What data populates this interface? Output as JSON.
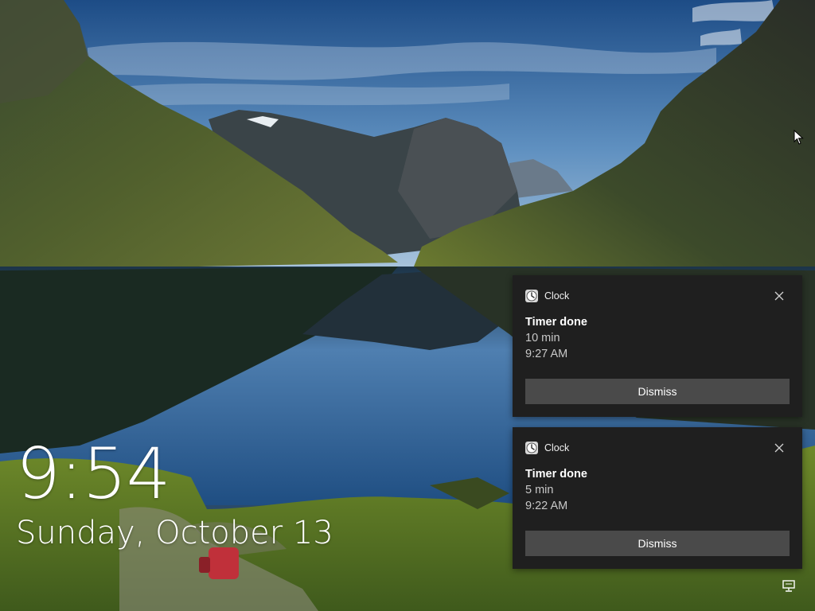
{
  "lock_screen": {
    "time": "9:54",
    "date": "Sunday, October 13"
  },
  "notifications": [
    {
      "app_name": "Clock",
      "app_icon": "clock-icon",
      "title": "Timer done",
      "duration": "10 min",
      "timestamp": "9:27 AM",
      "action_label": "Dismiss",
      "close_icon": "close-icon"
    },
    {
      "app_name": "Clock",
      "app_icon": "clock-icon",
      "title": "Timer done",
      "duration": "5 min",
      "timestamp": "9:22 AM",
      "action_label": "Dismiss",
      "close_icon": "close-icon"
    }
  ],
  "status_icons": [
    "network-icon"
  ],
  "colors": {
    "toast_background": "#1f1f1f",
    "dismiss_button": "#4a4a4a",
    "text_primary": "#ffffff",
    "text_secondary": "#c8c8c8"
  }
}
